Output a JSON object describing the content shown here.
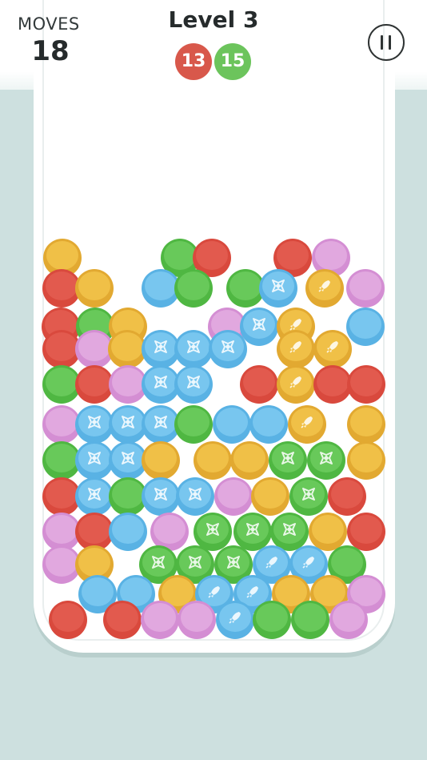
{
  "hud": {
    "moves_label": "MOVES",
    "moves_value": "18",
    "level_title": "Level 3",
    "targets": [
      {
        "value": "13",
        "color": "#d8584b"
      },
      {
        "value": "15",
        "color": "#6cc45c"
      }
    ],
    "pause_icon": "pause-icon"
  },
  "palette": {
    "red": {
      "base": "#d9493d",
      "top": "#e25a4e"
    },
    "green": {
      "base": "#4fb742",
      "top": "#68c95a"
    },
    "blue": {
      "base": "#59b2e4",
      "top": "#78c6ef"
    },
    "yellow": {
      "base": "#e2a931",
      "top": "#f0c047"
    },
    "pink": {
      "base": "#d48ed3",
      "top": "#e1a8df"
    }
  },
  "ball_rows": [
    [
      "yellow:none",
      "green:none",
      "red:none",
      "red:none",
      "pink:none",
      "pink:none"
    ],
    [
      "red:none",
      "yellow:none",
      "blue:none",
      "green:none",
      "green:none",
      "blue:star",
      "yellow:rocket",
      "pink:none"
    ],
    [
      "red:none",
      "green:none",
      "yellow:none",
      "pink:none",
      "blue:star",
      "yellow:rocket",
      "blue:none"
    ],
    [
      "red:none",
      "pink:none",
      "yellow:none",
      "blue:star",
      "blue:star",
      "blue:star",
      "yellow:rocket",
      "yellow:rocket"
    ],
    [
      "green:none",
      "red:none",
      "pink:none",
      "blue:star",
      "blue:star",
      "red:none",
      "yellow:rocket",
      "red:none",
      "red:none"
    ],
    [
      "pink:none",
      "blue:star",
      "blue:star",
      "blue:star",
      "green:none",
      "blue:none",
      "blue:none",
      "yellow:rocket",
      "yellow:none"
    ],
    [
      "green:none",
      "blue:star",
      "blue:star",
      "yellow:none",
      "yellow:none",
      "yellow:none",
      "green:star",
      "green:star",
      "yellow:none"
    ],
    [
      "red:none",
      "blue:star",
      "green:none",
      "blue:star",
      "blue:star",
      "pink:none",
      "yellow:none",
      "green:star",
      "red:none"
    ],
    [
      "pink:none",
      "red:none",
      "blue:none",
      "pink:none",
      "green:star",
      "green:star",
      "green:star",
      "yellow:none",
      "red:none"
    ],
    [
      "pink:none",
      "yellow:none",
      "green:star",
      "green:star",
      "green:star",
      "blue:rocket",
      "blue:rocket",
      "green:none"
    ],
    [
      "blue:none",
      "blue:none",
      "yellow:none",
      "blue:rocket",
      "blue:rocket",
      "yellow:none",
      "yellow:none",
      "pink:none"
    ],
    [
      "red:none",
      "red:none",
      "pink:none",
      "pink:none",
      "blue:rocket",
      "green:none",
      "green:none",
      "pink:none"
    ]
  ]
}
